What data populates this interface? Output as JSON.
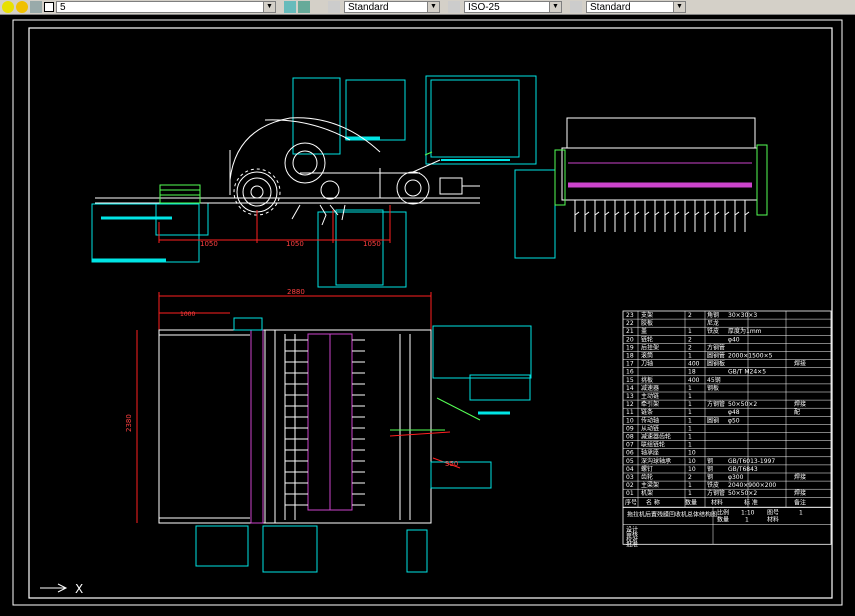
{
  "toolbar": {
    "layer_value": "5",
    "text_style": "Standard",
    "dim_style": "ISO-25",
    "table_style": "Standard"
  },
  "ucs": {
    "axis_label": "X"
  },
  "dimensions": {
    "d1": "1050",
    "d2": "1050",
    "d3": "1050",
    "d4": "2880",
    "d5": "1000",
    "d6": "2380",
    "d7": "350"
  },
  "bom": {
    "rows": [
      {
        "no": "23",
        "name": "支架",
        "qty": "2",
        "mat": "角钢",
        "std": "30×30×3",
        "note": ""
      },
      {
        "no": "22",
        "name": "胶板",
        "qty": "",
        "mat": "尼龙",
        "std": "",
        "note": ""
      },
      {
        "no": "21",
        "name": "盖",
        "qty": "1",
        "mat": "铁皮",
        "std": "厚度为1mm",
        "note": ""
      },
      {
        "no": "20",
        "name": "链轮",
        "qty": "2",
        "mat": "",
        "std": "φ40",
        "note": ""
      },
      {
        "no": "19",
        "name": "后挂架",
        "qty": "2",
        "mat": "方钢管",
        "std": "",
        "note": ""
      },
      {
        "no": "18",
        "name": "滚筒",
        "qty": "1",
        "mat": "圆钢管",
        "std": "2000×1500×5",
        "note": ""
      },
      {
        "no": "17",
        "name": "刀轴",
        "qty": "400",
        "mat": "圆钢板",
        "std": "",
        "note": "焊接"
      },
      {
        "no": "16",
        "name": "",
        "qty": "18",
        "mat": "",
        "std": "GB/T M24×5",
        "note": ""
      },
      {
        "no": "15",
        "name": "挑板",
        "qty": "400",
        "mat": "45钢",
        "std": "",
        "note": ""
      },
      {
        "no": "14",
        "name": "减速器",
        "qty": "1",
        "mat": "钢板",
        "std": "",
        "note": ""
      },
      {
        "no": "13",
        "name": "主动链",
        "qty": "1",
        "mat": "",
        "std": "",
        "note": ""
      },
      {
        "no": "12",
        "name": "牵引架",
        "qty": "1",
        "mat": "方钢管",
        "std": "50×50×2",
        "note": "焊接"
      },
      {
        "no": "11",
        "name": "链条",
        "qty": "1",
        "mat": "",
        "std": "φ48",
        "note": "配"
      },
      {
        "no": "10",
        "name": "传动轴",
        "qty": "1",
        "mat": "圆钢",
        "std": "φ50",
        "note": ""
      },
      {
        "no": "09",
        "name": "从动链",
        "qty": "1",
        "mat": "",
        "std": "",
        "note": ""
      },
      {
        "no": "08",
        "name": "减速器齿轮",
        "qty": "1",
        "mat": "",
        "std": "",
        "note": ""
      },
      {
        "no": "07",
        "name": "联组链轮",
        "qty": "1",
        "mat": "",
        "std": "",
        "note": ""
      },
      {
        "no": "06",
        "name": "轴承座",
        "qty": "10",
        "mat": "",
        "std": "",
        "note": ""
      },
      {
        "no": "05",
        "name": "深沟球轴承",
        "qty": "10",
        "mat": "钢",
        "std": "GB/T6013-1997",
        "note": ""
      },
      {
        "no": "04",
        "name": "螺钉",
        "qty": "10",
        "mat": "钢",
        "std": "GB/T6843",
        "note": ""
      },
      {
        "no": "03",
        "name": "齿轮",
        "qty": "2",
        "mat": "钢",
        "std": "φ300",
        "note": "焊接"
      },
      {
        "no": "02",
        "name": "主梁架",
        "qty": "1",
        "mat": "铁皮",
        "std": "2040×900×200",
        "note": ""
      },
      {
        "no": "01",
        "name": "机架",
        "qty": "1",
        "mat": "方钢管",
        "std": "50×50×2",
        "note": "焊接"
      }
    ],
    "header": {
      "no": "序号",
      "name": "名 称",
      "qty": "数量",
      "mat": "材料",
      "std": "标 准",
      "note": "备注"
    }
  },
  "titleblock": {
    "title": "拖拉机后置残膜回收机总体结构图",
    "ratio_label": "比例",
    "ratio": "1:10",
    "sheet_label": "图号",
    "sheet": "1",
    "count_label": "数量",
    "count": "1",
    "mat_label": "材料",
    "r1": "设计",
    "r2": "审核",
    "r3": "校对",
    "r4": "批准"
  }
}
